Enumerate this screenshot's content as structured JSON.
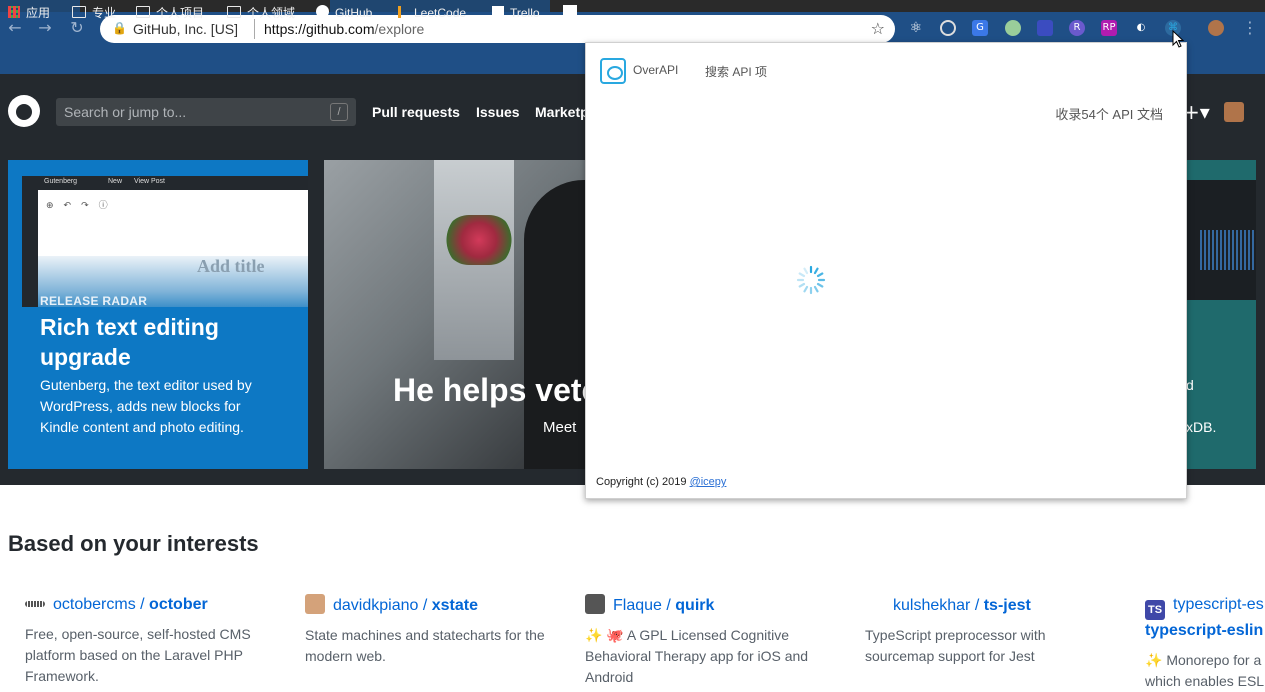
{
  "browser": {
    "omnibox": {
      "security_label": "GitHub, Inc. [US]",
      "url_host": "https://github.com",
      "url_path": "/explore"
    },
    "bookmarks": [
      {
        "label": "应用",
        "icon": "apps-grid-icon"
      },
      {
        "label": "专业",
        "icon": "folder-icon"
      },
      {
        "label": "个人项目",
        "icon": "folder-icon"
      },
      {
        "label": "个人领域",
        "icon": "folder-icon"
      },
      {
        "label": "GitHub",
        "icon": "github-icon"
      },
      {
        "label": "LeetCode",
        "icon": "leetcode-icon"
      },
      {
        "label": "Trello",
        "icon": "trello-icon"
      }
    ],
    "accent": "#1f4f86"
  },
  "github": {
    "search_placeholder": "Search or jump to...",
    "search_shortcut": "/",
    "nav": [
      "Pull requests",
      "Issues",
      "Marketp"
    ],
    "hero": {
      "card1": {
        "kicker": "RELEASE RADAR",
        "title": "Rich text editing upgrade",
        "description": "Gutenberg, the text editor used by WordPress, adds new blocks for Kindle content and photo editing.",
        "screenshot_title": "Add title",
        "screenshot_menu": [
          "Gutenberg",
          "New",
          "View Post"
        ]
      },
      "card2": {
        "title": "He helps vete",
        "subtitle": "Meet"
      },
      "card3": {
        "line1": "d",
        "line2": "xDB."
      }
    },
    "interests_title": "Based on your interests",
    "repos": [
      {
        "owner": "octobercms",
        "name": "october",
        "description": "Free, open-source, self-hosted CMS platform based on the Laravel PHP Framework."
      },
      {
        "owner": "davidkpiano",
        "name": "xstate",
        "description": "State machines and statecharts for the modern web."
      },
      {
        "owner": "Flaque",
        "name": "quirk",
        "description": "✨ 🐙 A GPL Licensed Cognitive Behavioral Therapy app for iOS and Android"
      },
      {
        "owner": "kulshekhar",
        "name": "ts-jest",
        "description": "TypeScript preprocessor with sourcemap support for Jest"
      },
      {
        "owner": "typescript-es",
        "name": "typescript-eslin",
        "description": "✨ Monorepo for a which enables ESL"
      }
    ]
  },
  "popup": {
    "app_name": "OverAPI",
    "search_label": "搜索 API 项",
    "count_label": "收录54个 API 文档",
    "copyright": "Copyright (c) 2019",
    "author_link": "@icepy",
    "accent": "#29a8e0"
  }
}
